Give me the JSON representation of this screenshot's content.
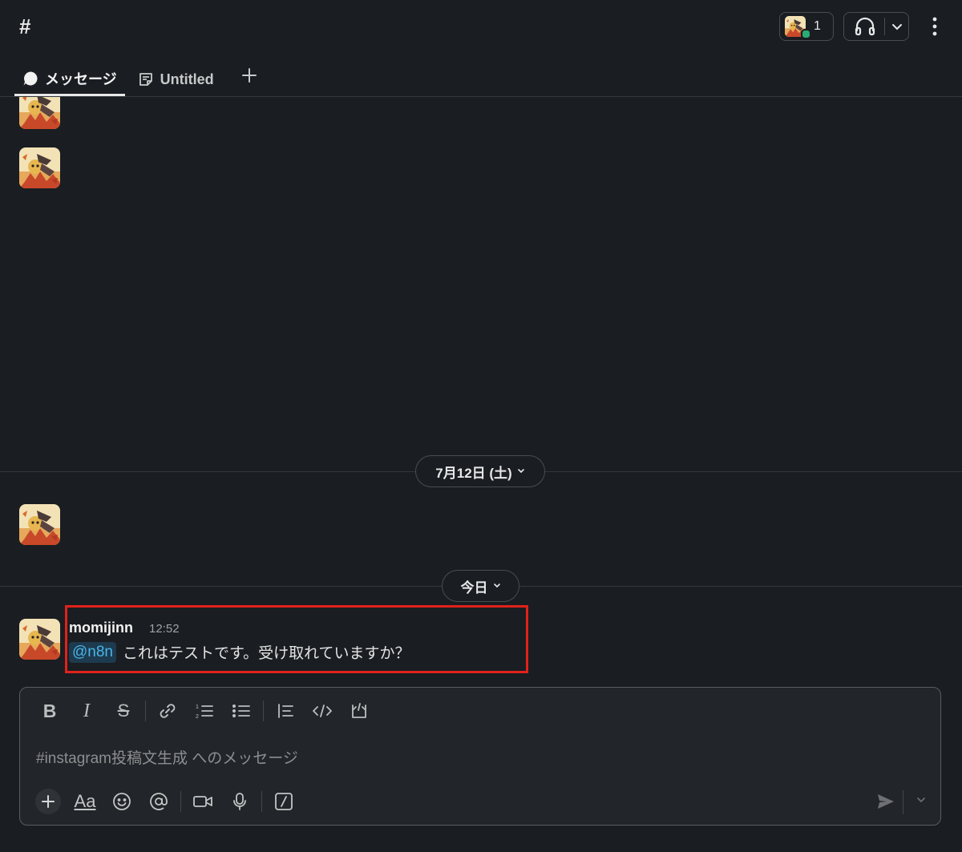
{
  "header": {
    "channel_symbol": "#",
    "member_count": "1",
    "tabs": [
      {
        "label": "メッセージ",
        "active": true
      },
      {
        "label": "Untitled",
        "active": false
      }
    ]
  },
  "dates": {
    "first": "7月12日 (土)",
    "today": "今日"
  },
  "message": {
    "author": "momijinn",
    "time": "12:52",
    "mention": "@n8n",
    "text": "これはテストです。受け取れていますか？"
  },
  "composer": {
    "placeholder": "#instagram投稿文生成 へのメッセージ",
    "format_label": "Aa"
  },
  "colors": {
    "background": "#1a1d21",
    "mention_text": "#4ab4e8",
    "highlight_border": "#e0221b",
    "online_dot": "#2bac76"
  },
  "icons": [
    "hash-icon",
    "headphones-icon",
    "chevron-down-icon",
    "more-vertical-icon",
    "message-bubble-icon",
    "canvas-doc-icon",
    "plus-icon",
    "bold-icon",
    "italic-icon",
    "strikethrough-icon",
    "link-icon",
    "ordered-list-icon",
    "bulleted-list-icon",
    "blockquote-icon",
    "code-icon",
    "code-block-icon",
    "emoji-icon",
    "at-mention-icon",
    "video-icon",
    "microphone-icon",
    "slash-command-icon",
    "send-icon"
  ]
}
